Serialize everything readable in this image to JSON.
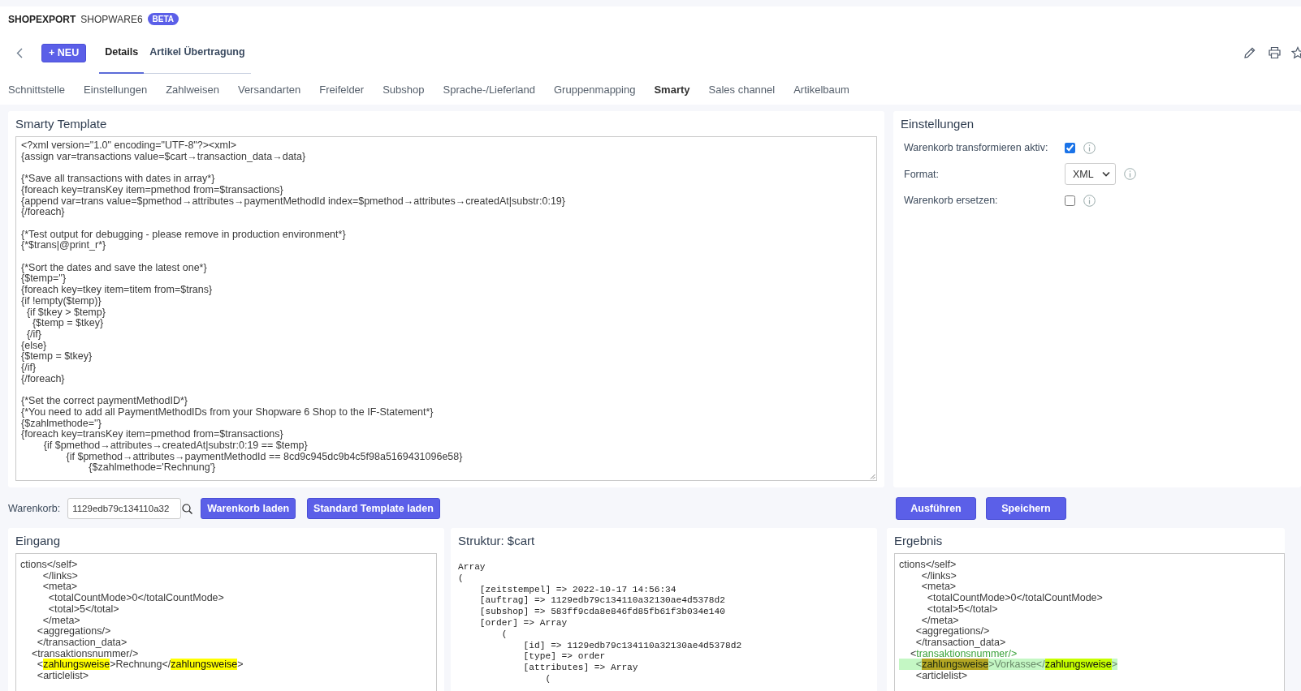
{
  "header": {
    "title": "SHOPEXPORT",
    "subtitle": "SHOPWARE6",
    "badge": "BETA"
  },
  "toolbar": {
    "new_button": "+ NEU",
    "tabs": [
      {
        "label": "Details",
        "selected": true
      },
      {
        "label": "Artikel Übertragung",
        "selected": false
      }
    ]
  },
  "nav_tabs": [
    {
      "label": "Schnittstelle",
      "selected": false
    },
    {
      "label": "Einstellungen",
      "selected": false
    },
    {
      "label": "Zahlweisen",
      "selected": false
    },
    {
      "label": "Versandarten",
      "selected": false
    },
    {
      "label": "Freifelder",
      "selected": false
    },
    {
      "label": "Subshop",
      "selected": false
    },
    {
      "label": "Sprache-/Lieferland",
      "selected": false
    },
    {
      "label": "Gruppenmapping",
      "selected": false
    },
    {
      "label": "Smarty",
      "selected": true
    },
    {
      "label": "Sales channel",
      "selected": false
    },
    {
      "label": "Artikelbaum",
      "selected": false
    }
  ],
  "template_card": {
    "title": "Smarty Template",
    "text": "<?xml version=\"1.0\" encoding=\"UTF-8\"?><xml>\n{assign var=transactions value=$cart→transaction_data→data}\n\n{*Save all transactions with dates in array*}\n{foreach key=transKey item=pmethod from=$transactions}\n{append var=trans value=$pmethod→attributes→paymentMethodId index=$pmethod→attributes→createdAt|substr:0:19}\n{/foreach}\n\n{*Test output for debugging - please remove in production environment*}\n{*$trans|@print_r*}\n\n{*Sort the dates and save the latest one*}\n{$temp=''}\n{foreach key=tkey item=titem from=$trans}\n{if !empty($temp)}\n  {if $tkey > $temp}\n    {$temp = $tkey}\n  {/if}\n{else}\n{$temp = $tkey}\n{/if}\n{/foreach}\n\n{*Set the correct paymentMethodID*}\n{*You need to add all PaymentMethodIDs from your Shopware 6 Shop to the IF-Statement*}\n{$zahlmethode=''}\n{foreach key=transKey item=pmethod from=$transactions}\n        {if $pmethod→attributes→createdAt|substr:0:19 == $temp}\n                {if $pmethod→attributes→paymentMethodId == 8cd9c945dc9b4c5f98a5169431096e58}\n                        {$zahlmethode='Rechnung'}"
  },
  "settings": {
    "title": "Einstellungen",
    "rows": [
      {
        "kind": "checkbox",
        "label": "Warenkorb transformieren aktiv:",
        "checked": true
      },
      {
        "kind": "select",
        "label": "Format:",
        "value": "XML"
      },
      {
        "kind": "checkbox",
        "label": "Warenkorb ersetzen:",
        "checked": false
      }
    ]
  },
  "cart_bar": {
    "label": "Warenkorb:",
    "value": "1129edb79c134110a32",
    "buttons": [
      "Warenkorb laden",
      "Standard Template laden"
    ]
  },
  "actions": [
    "Ausführen",
    "Speichern"
  ],
  "panels": [
    {
      "title": "Eingang",
      "kind": "xml",
      "lines": [
        "ctions</self>",
        "        </links>",
        "        <meta>",
        "          <totalCountMode>0</totalCountMode>",
        "          <total>5</total>",
        "        </meta>",
        "      <aggregations/>",
        "      </transaction_data>",
        "    <transaktionsnummer/>",
        {
          "highlighted": false,
          "segments": [
            {
              "text": "      <",
              "kind": "plain"
            },
            {
              "text": "zahlungsweise",
              "kind": "match"
            },
            {
              "text": ">Rechnung</",
              "kind": "plain"
            },
            {
              "text": "zahlungsweise",
              "kind": "match"
            },
            {
              "text": ">",
              "kind": "plain"
            }
          ]
        },
        "      <articlelist>"
      ]
    },
    {
      "title": "Struktur: $cart",
      "kind": "dump",
      "lines": [
        "Array",
        "(",
        "    [zeitstempel] => 2022-10-17 14:56:34",
        "    [auftrag] => 1129edb79c134110a32130ae4d5378d2",
        "    [subshop] => 583ff9cda8e846fd85fb61f3b034e140",
        "    [order] => Array",
        "        (",
        "            [id] => 1129edb79c134110a32130ae4d5378d2",
        "            [type] => order",
        "            [attributes] => Array",
        "                ("
      ]
    },
    {
      "title": "Ergebnis",
      "kind": "xml",
      "lines": [
        "ctions</self>",
        "        </links>",
        "        <meta>",
        "          <totalCountMode>0</totalCountMode>",
        "          <total>5</total>",
        "        </meta>",
        "      <aggregations/>",
        "      </transaction_data>",
        {
          "highlighted": false,
          "segments": [
            {
              "text": "    <",
              "kind": "plain"
            },
            {
              "text": "transaktionsnummer/>",
              "kind": "changed"
            }
          ]
        },
        {
          "highlighted": true,
          "segments": [
            {
              "text": "      <",
              "kind": "plain"
            },
            {
              "text": "zahlungsweise",
              "kind": "current"
            },
            {
              "text": ">Vorkasse</",
              "kind": "plain"
            },
            {
              "text": "zahlungsweise",
              "kind": "match"
            },
            {
              "text": ">",
              "kind": "plain"
            }
          ]
        },
        "      <articlelist>"
      ]
    }
  ]
}
